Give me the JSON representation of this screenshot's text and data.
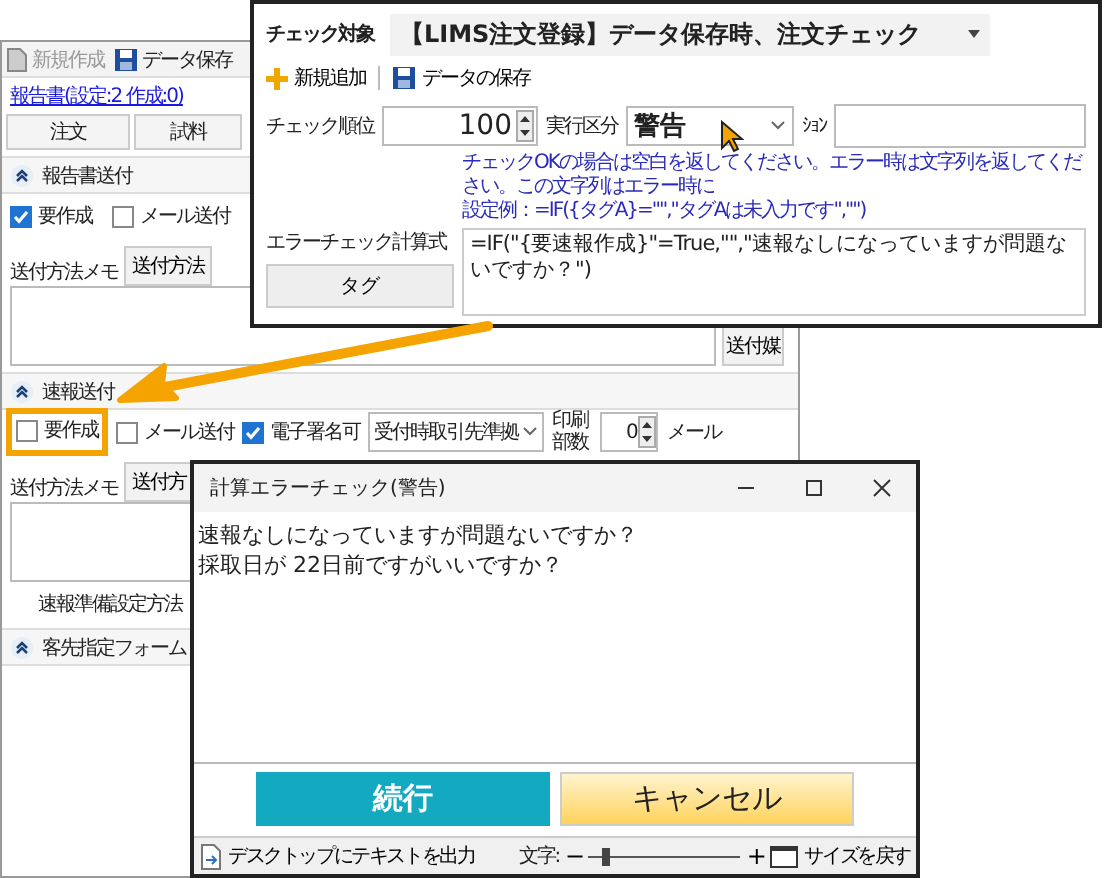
{
  "main_window": {
    "toolbar": [
      {
        "label": "新規作成",
        "disabled": true
      },
      {
        "label": "データ保存",
        "disabled": false
      }
    ],
    "report_link": "報告書(設定:2 作成:0)",
    "columns": [
      "注文",
      "試料"
    ],
    "report_section": {
      "title": "報告書送付",
      "expanded": true,
      "create": {
        "label": "要作成",
        "checked": true
      },
      "mail": {
        "label": "メール送付",
        "checked": false
      },
      "memo_label": "送付方法メモ",
      "memo_tabs": [
        "送付方法"
      ],
      "side_label": "送付媒"
    },
    "urgent_section": {
      "title": "速報送付",
      "expanded": true,
      "create": {
        "label": "要作成",
        "checked": false
      },
      "mail": {
        "label": "メール送付",
        "checked": false
      },
      "esign": {
        "label": "電子署名可",
        "checked": true
      },
      "delivery": "受付時取引先準拠",
      "copies_label": "印刷部数",
      "copies": "0",
      "mail_to": "メール",
      "memo_label": "送付方法メモ",
      "memo_tabs": [
        "送付方"
      ],
      "prep_label": "速報準備設定方法"
    },
    "client_section": {
      "title": "客先指定フォーム",
      "expanded": true
    }
  },
  "check_window": {
    "target_label": "チェック対象",
    "target": "【LIMS注文登録】データ保存時、注文チェック",
    "toolbar": [
      "新規追加",
      "データの保存"
    ],
    "order_label": "チェック順位",
    "order": "100",
    "exec_label": "実行区分",
    "exec": "警告",
    "option_label": "ｼｮﾝ",
    "help": [
      "チェックOKの場合は空白を返してください。エラー時は文字列を返してください。この文字列はエラー時に",
      "設定例：=IF({タグA}=\"\",\"タグAは未入力です\",\"\")"
    ],
    "formula_label": "エラーチェック計算式",
    "formula": "=IF(\"{要速報作成}\"=True,\"\",\"速報なしになっていますが問題ないですか？\")",
    "tag_button": "タグ"
  },
  "dialog": {
    "title": "計算エラーチェック(警告)",
    "messages": [
      "速報なしになっていますが問題ないですか？",
      "採取日が 22日前ですがいいですか？"
    ],
    "buttons": [
      {
        "label": "続行",
        "kind": "primary"
      },
      {
        "label": "キャンセル",
        "kind": "cancel"
      }
    ],
    "status": {
      "export": "デスクトップにテキストを出力",
      "font_label": "文字:",
      "minus": "−",
      "plus": "+",
      "level": 0.12,
      "reset": "サイズを戻す"
    }
  }
}
